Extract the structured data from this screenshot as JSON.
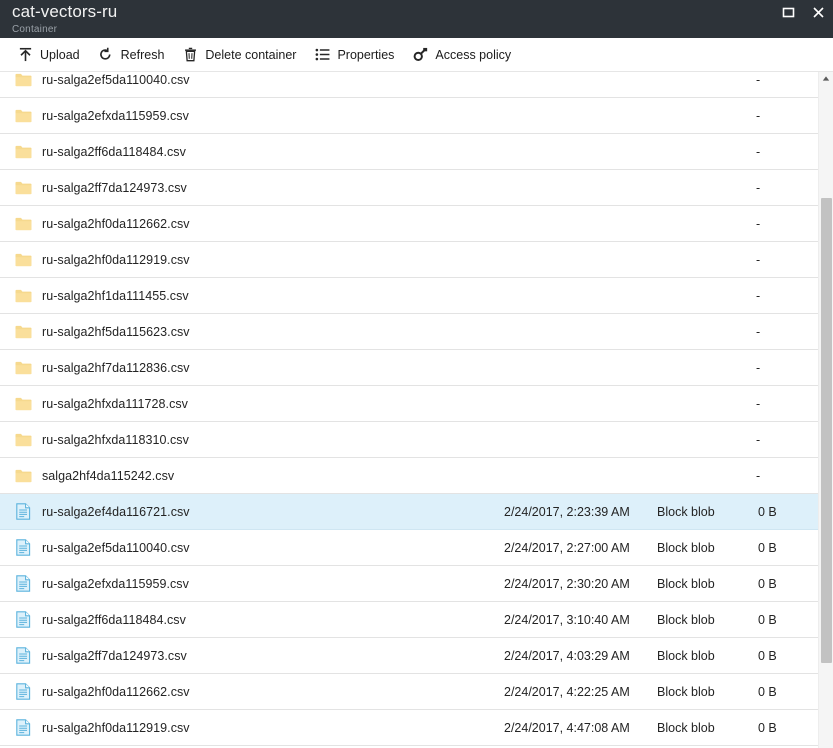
{
  "window": {
    "title": "cat-vectors-ru",
    "subtitle": "Container",
    "maximize_label": "Maximize",
    "close_label": "Close"
  },
  "toolbar": {
    "items": [
      {
        "label": "Upload",
        "icon": "upload-icon"
      },
      {
        "label": "Refresh",
        "icon": "refresh-icon"
      },
      {
        "label": "Delete container",
        "icon": "trash-icon"
      },
      {
        "label": "Properties",
        "icon": "properties-list-icon"
      },
      {
        "label": "Access policy",
        "icon": "key-icon"
      }
    ]
  },
  "list": {
    "placeholder_dash": "-",
    "rows": [
      {
        "name": "ru-salga2ef5da110040.csv",
        "kind": "folder",
        "date": "",
        "type": "",
        "size": "",
        "selected": false
      },
      {
        "name": "ru-salga2efxda115959.csv",
        "kind": "folder",
        "date": "",
        "type": "",
        "size": "",
        "selected": false
      },
      {
        "name": "ru-salga2ff6da118484.csv",
        "kind": "folder",
        "date": "",
        "type": "",
        "size": "",
        "selected": false
      },
      {
        "name": "ru-salga2ff7da124973.csv",
        "kind": "folder",
        "date": "",
        "type": "",
        "size": "",
        "selected": false
      },
      {
        "name": "ru-salga2hf0da112662.csv",
        "kind": "folder",
        "date": "",
        "type": "",
        "size": "",
        "selected": false
      },
      {
        "name": "ru-salga2hf0da112919.csv",
        "kind": "folder",
        "date": "",
        "type": "",
        "size": "",
        "selected": false
      },
      {
        "name": "ru-salga2hf1da111455.csv",
        "kind": "folder",
        "date": "",
        "type": "",
        "size": "",
        "selected": false
      },
      {
        "name": "ru-salga2hf5da115623.csv",
        "kind": "folder",
        "date": "",
        "type": "",
        "size": "",
        "selected": false
      },
      {
        "name": "ru-salga2hf7da112836.csv",
        "kind": "folder",
        "date": "",
        "type": "",
        "size": "",
        "selected": false
      },
      {
        "name": "ru-salga2hfxda111728.csv",
        "kind": "folder",
        "date": "",
        "type": "",
        "size": "",
        "selected": false
      },
      {
        "name": "ru-salga2hfxda118310.csv",
        "kind": "folder",
        "date": "",
        "type": "",
        "size": "",
        "selected": false
      },
      {
        "name": "salga2hf4da115242.csv",
        "kind": "folder",
        "date": "",
        "type": "",
        "size": "",
        "selected": false
      },
      {
        "name": "ru-salga2ef4da116721.csv",
        "kind": "file",
        "date": "2/24/2017, 2:23:39 AM",
        "type": "Block blob",
        "size": "0 B",
        "selected": true
      },
      {
        "name": "ru-salga2ef5da110040.csv",
        "kind": "file",
        "date": "2/24/2017, 2:27:00 AM",
        "type": "Block blob",
        "size": "0 B",
        "selected": false
      },
      {
        "name": "ru-salga2efxda115959.csv",
        "kind": "file",
        "date": "2/24/2017, 2:30:20 AM",
        "type": "Block blob",
        "size": "0 B",
        "selected": false
      },
      {
        "name": "ru-salga2ff6da118484.csv",
        "kind": "file",
        "date": "2/24/2017, 3:10:40 AM",
        "type": "Block blob",
        "size": "0 B",
        "selected": false
      },
      {
        "name": "ru-salga2ff7da124973.csv",
        "kind": "file",
        "date": "2/24/2017, 4:03:29 AM",
        "type": "Block blob",
        "size": "0 B",
        "selected": false
      },
      {
        "name": "ru-salga2hf0da112662.csv",
        "kind": "file",
        "date": "2/24/2017, 4:22:25 AM",
        "type": "Block blob",
        "size": "0 B",
        "selected": false
      },
      {
        "name": "ru-salga2hf0da112919.csv",
        "kind": "file",
        "date": "2/24/2017, 4:47:08 AM",
        "type": "Block blob",
        "size": "0 B",
        "selected": false
      }
    ]
  },
  "colors": {
    "titlebar_bg": "#2d3339",
    "selection_bg": "#ddf0fa",
    "folder_icon": "#f5d88f",
    "file_icon": "#5ab4e0",
    "scrollbar_thumb": "#c2c2c2"
  }
}
